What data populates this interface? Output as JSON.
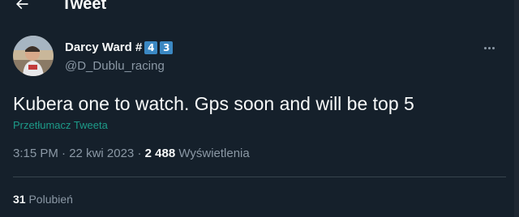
{
  "header": {
    "title": "Tweet",
    "back_icon": "arrow-left-icon"
  },
  "author": {
    "name": "Darcy Ward #",
    "badges": [
      "4",
      "3"
    ],
    "handle": "@D_Dublu_racing"
  },
  "tweet": {
    "text": "Kubera one to watch. Gps soon and will be top 5",
    "translate_label": "Przetłumacz Tweeta"
  },
  "meta": {
    "time": "3:15 PM",
    "separator": "·",
    "date": "22 kwi 2023",
    "views_count": "2 488",
    "views_label": "Wyświetlenia"
  },
  "stats": {
    "likes_count": "31",
    "likes_label": "Polubień"
  },
  "colors": {
    "background": "#15202b",
    "text": "#f7f9f9",
    "secondary": "#8b98a5",
    "link": "#1d9b89",
    "divider": "#38444d",
    "badge": "#3b88c3"
  }
}
